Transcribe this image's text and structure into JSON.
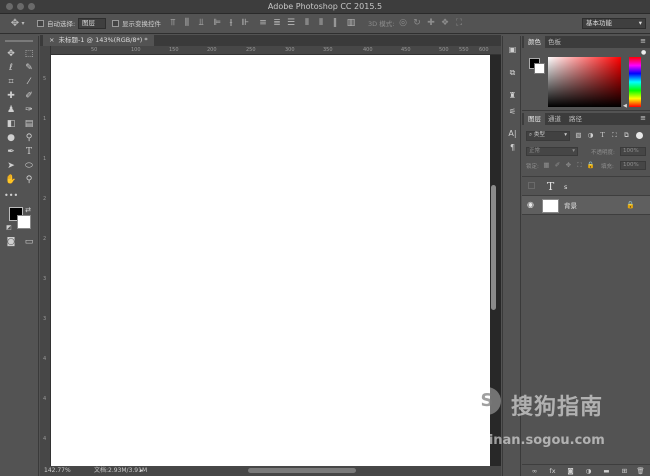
{
  "window": {
    "title": "Adobe Photoshop CC 2015.5"
  },
  "options_bar": {
    "auto_select_label": "自动选择:",
    "auto_select_value": "图层",
    "show_transform_label": "显示变换控件",
    "mode_3d_label": "3D 模式:",
    "workspace_value": "基本功能"
  },
  "document": {
    "tab_label": "未标题-1 @ 143%(RGB/8*) *",
    "ruler_h": [
      "50",
      "100",
      "150",
      "200",
      "250",
      "300",
      "350",
      "400",
      "450",
      "500",
      "550",
      "600"
    ],
    "ruler_v": [
      "5",
      "1",
      "1",
      "2",
      "2",
      "3",
      "3",
      "4",
      "4",
      "4"
    ]
  },
  "status_bar": {
    "zoom": "142.77%",
    "doc_info": "文档:2.93M/3.91M"
  },
  "color_panel": {
    "tabs": [
      "颜色",
      "色板"
    ],
    "fg_color": "#000000",
    "bg_color": "#ffffff"
  },
  "layers_panel": {
    "tabs": [
      "图层",
      "通道",
      "路径"
    ],
    "filter_kind": "类型",
    "blend_mode": "正常",
    "opacity_label": "不透明度:",
    "opacity_value": "100%",
    "lock_label": "锁定:",
    "fill_label": "填充:",
    "fill_value": "100%",
    "layers": [
      {
        "name": "s",
        "kind": "text",
        "visible": false
      },
      {
        "name": "背景",
        "kind": "background",
        "visible": true,
        "locked": true
      }
    ]
  },
  "watermark": {
    "logo": "S",
    "brand": "搜狗指南",
    "url": "zhinan.sogou.com"
  },
  "colors": {
    "ui_bg": "#535353",
    "dark_bar": "#3d3d3d",
    "canvas": "#ffffff"
  }
}
